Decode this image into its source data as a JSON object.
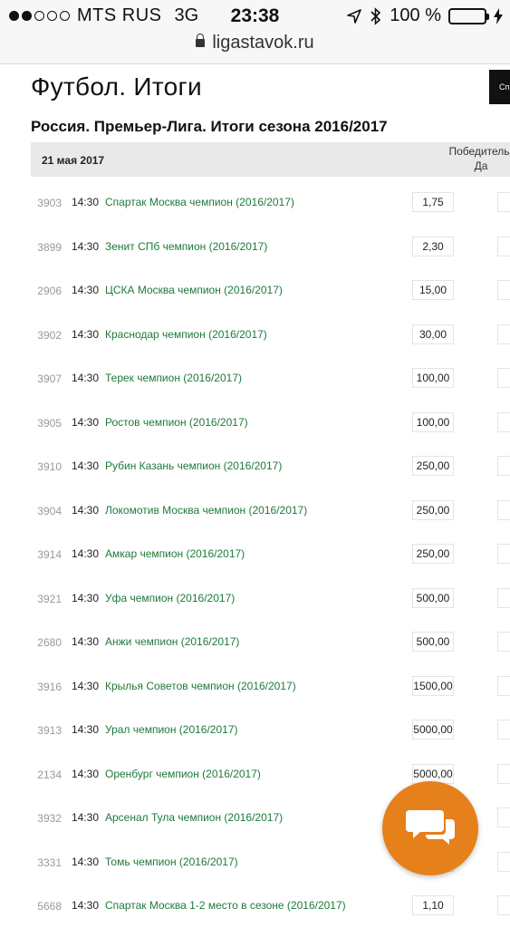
{
  "statusbar": {
    "carrier": "MTS RUS",
    "network": "3G",
    "time": "23:38",
    "battery": "100 %",
    "battery_level": 1.0,
    "url": "ligastavok.ru",
    "signal_dots_filled": 2,
    "signal_dots_total": 5,
    "icons": [
      "location-arrow-icon",
      "bluetooth-icon",
      "battery-icon",
      "charging-bolt-icon",
      "lock-icon"
    ]
  },
  "page": {
    "title": "Футбол. Итоги",
    "top_button": "Сп",
    "section_title": "Россия. Премьер-Лига. Итоги сезона 2016/2017",
    "date": "21 мая 2017",
    "column_header_line1": "Победитель-",
    "column_header_line2": "Да"
  },
  "rows": [
    {
      "id": "3903",
      "time": "14:30",
      "name": "Спартак Москва чемпион (2016/2017)",
      "odd": "1,75"
    },
    {
      "id": "3899",
      "time": "14:30",
      "name": "Зенит СПб чемпион (2016/2017)",
      "odd": "2,30"
    },
    {
      "id": "2906",
      "time": "14:30",
      "name": "ЦСКА Москва чемпион (2016/2017)",
      "odd": "15,00"
    },
    {
      "id": "3902",
      "time": "14:30",
      "name": "Краснодар чемпион (2016/2017)",
      "odd": "30,00"
    },
    {
      "id": "3907",
      "time": "14:30",
      "name": "Терек чемпион (2016/2017)",
      "odd": "100,00"
    },
    {
      "id": "3905",
      "time": "14:30",
      "name": "Ростов чемпион (2016/2017)",
      "odd": "100,00"
    },
    {
      "id": "3910",
      "time": "14:30",
      "name": "Рубин Казань чемпион (2016/2017)",
      "odd": "250,00"
    },
    {
      "id": "3904",
      "time": "14:30",
      "name": "Локомотив Москва чемпион (2016/2017)",
      "odd": "250,00"
    },
    {
      "id": "3914",
      "time": "14:30",
      "name": "Амкар чемпион (2016/2017)",
      "odd": "250,00"
    },
    {
      "id": "3921",
      "time": "14:30",
      "name": "Уфа чемпион (2016/2017)",
      "odd": "500,00"
    },
    {
      "id": "2680",
      "time": "14:30",
      "name": "Анжи чемпион (2016/2017)",
      "odd": "500,00"
    },
    {
      "id": "3916",
      "time": "14:30",
      "name": "Крылья Советов чемпион (2016/2017)",
      "odd": "1500,00"
    },
    {
      "id": "3913",
      "time": "14:30",
      "name": "Урал чемпион (2016/2017)",
      "odd": "5000,00"
    },
    {
      "id": "2134",
      "time": "14:30",
      "name": "Оренбург чемпион (2016/2017)",
      "odd": "5000,00"
    },
    {
      "id": "3932",
      "time": "14:30",
      "name": "Арсенал Тула чемпион (2016/2017)",
      "odd": ""
    },
    {
      "id": "3331",
      "time": "14:30",
      "name": "Томь чемпион (2016/2017)",
      "odd": ""
    },
    {
      "id": "5668",
      "time": "14:30",
      "name": "Спартак Москва 1-2 место в сезоне (2016/2017)",
      "odd": "1,10"
    }
  ],
  "chat": {
    "icon": "chat-bubbles-icon",
    "color": "#e6801a"
  }
}
